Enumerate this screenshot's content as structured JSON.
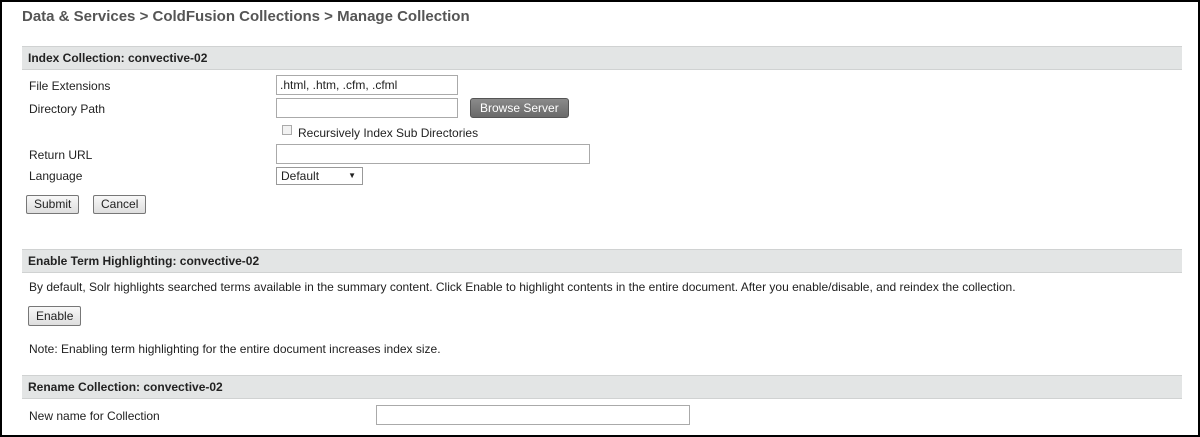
{
  "breadcrumb": "Data & Services > ColdFusion Collections > Manage Collection",
  "index_section": {
    "title": "Index Collection: convective-02",
    "file_extensions_label": "File Extensions",
    "file_extensions_value": ".html, .htm, .cfm, .cfml",
    "directory_path_label": "Directory Path",
    "directory_path_value": "",
    "browse_button": "Browse Server",
    "recursive_label": "Recursively Index Sub Directories",
    "recursive_checked": false,
    "return_url_label": "Return URL",
    "return_url_value": "",
    "language_label": "Language",
    "language_value": "Default",
    "submit_button": "Submit",
    "cancel_button": "Cancel"
  },
  "highlight_section": {
    "title": "Enable Term Highlighting: convective-02",
    "description": "By default, Solr highlights searched terms available in the summary content. Click Enable to highlight contents in the entire document. After you enable/disable, and reindex the collection.",
    "enable_button": "Enable",
    "note": "Note: Enabling term highlighting for the entire document increases index size."
  },
  "rename_section": {
    "title": "Rename Collection: convective-02",
    "new_name_label": "New name for Collection",
    "new_name_value": ""
  }
}
